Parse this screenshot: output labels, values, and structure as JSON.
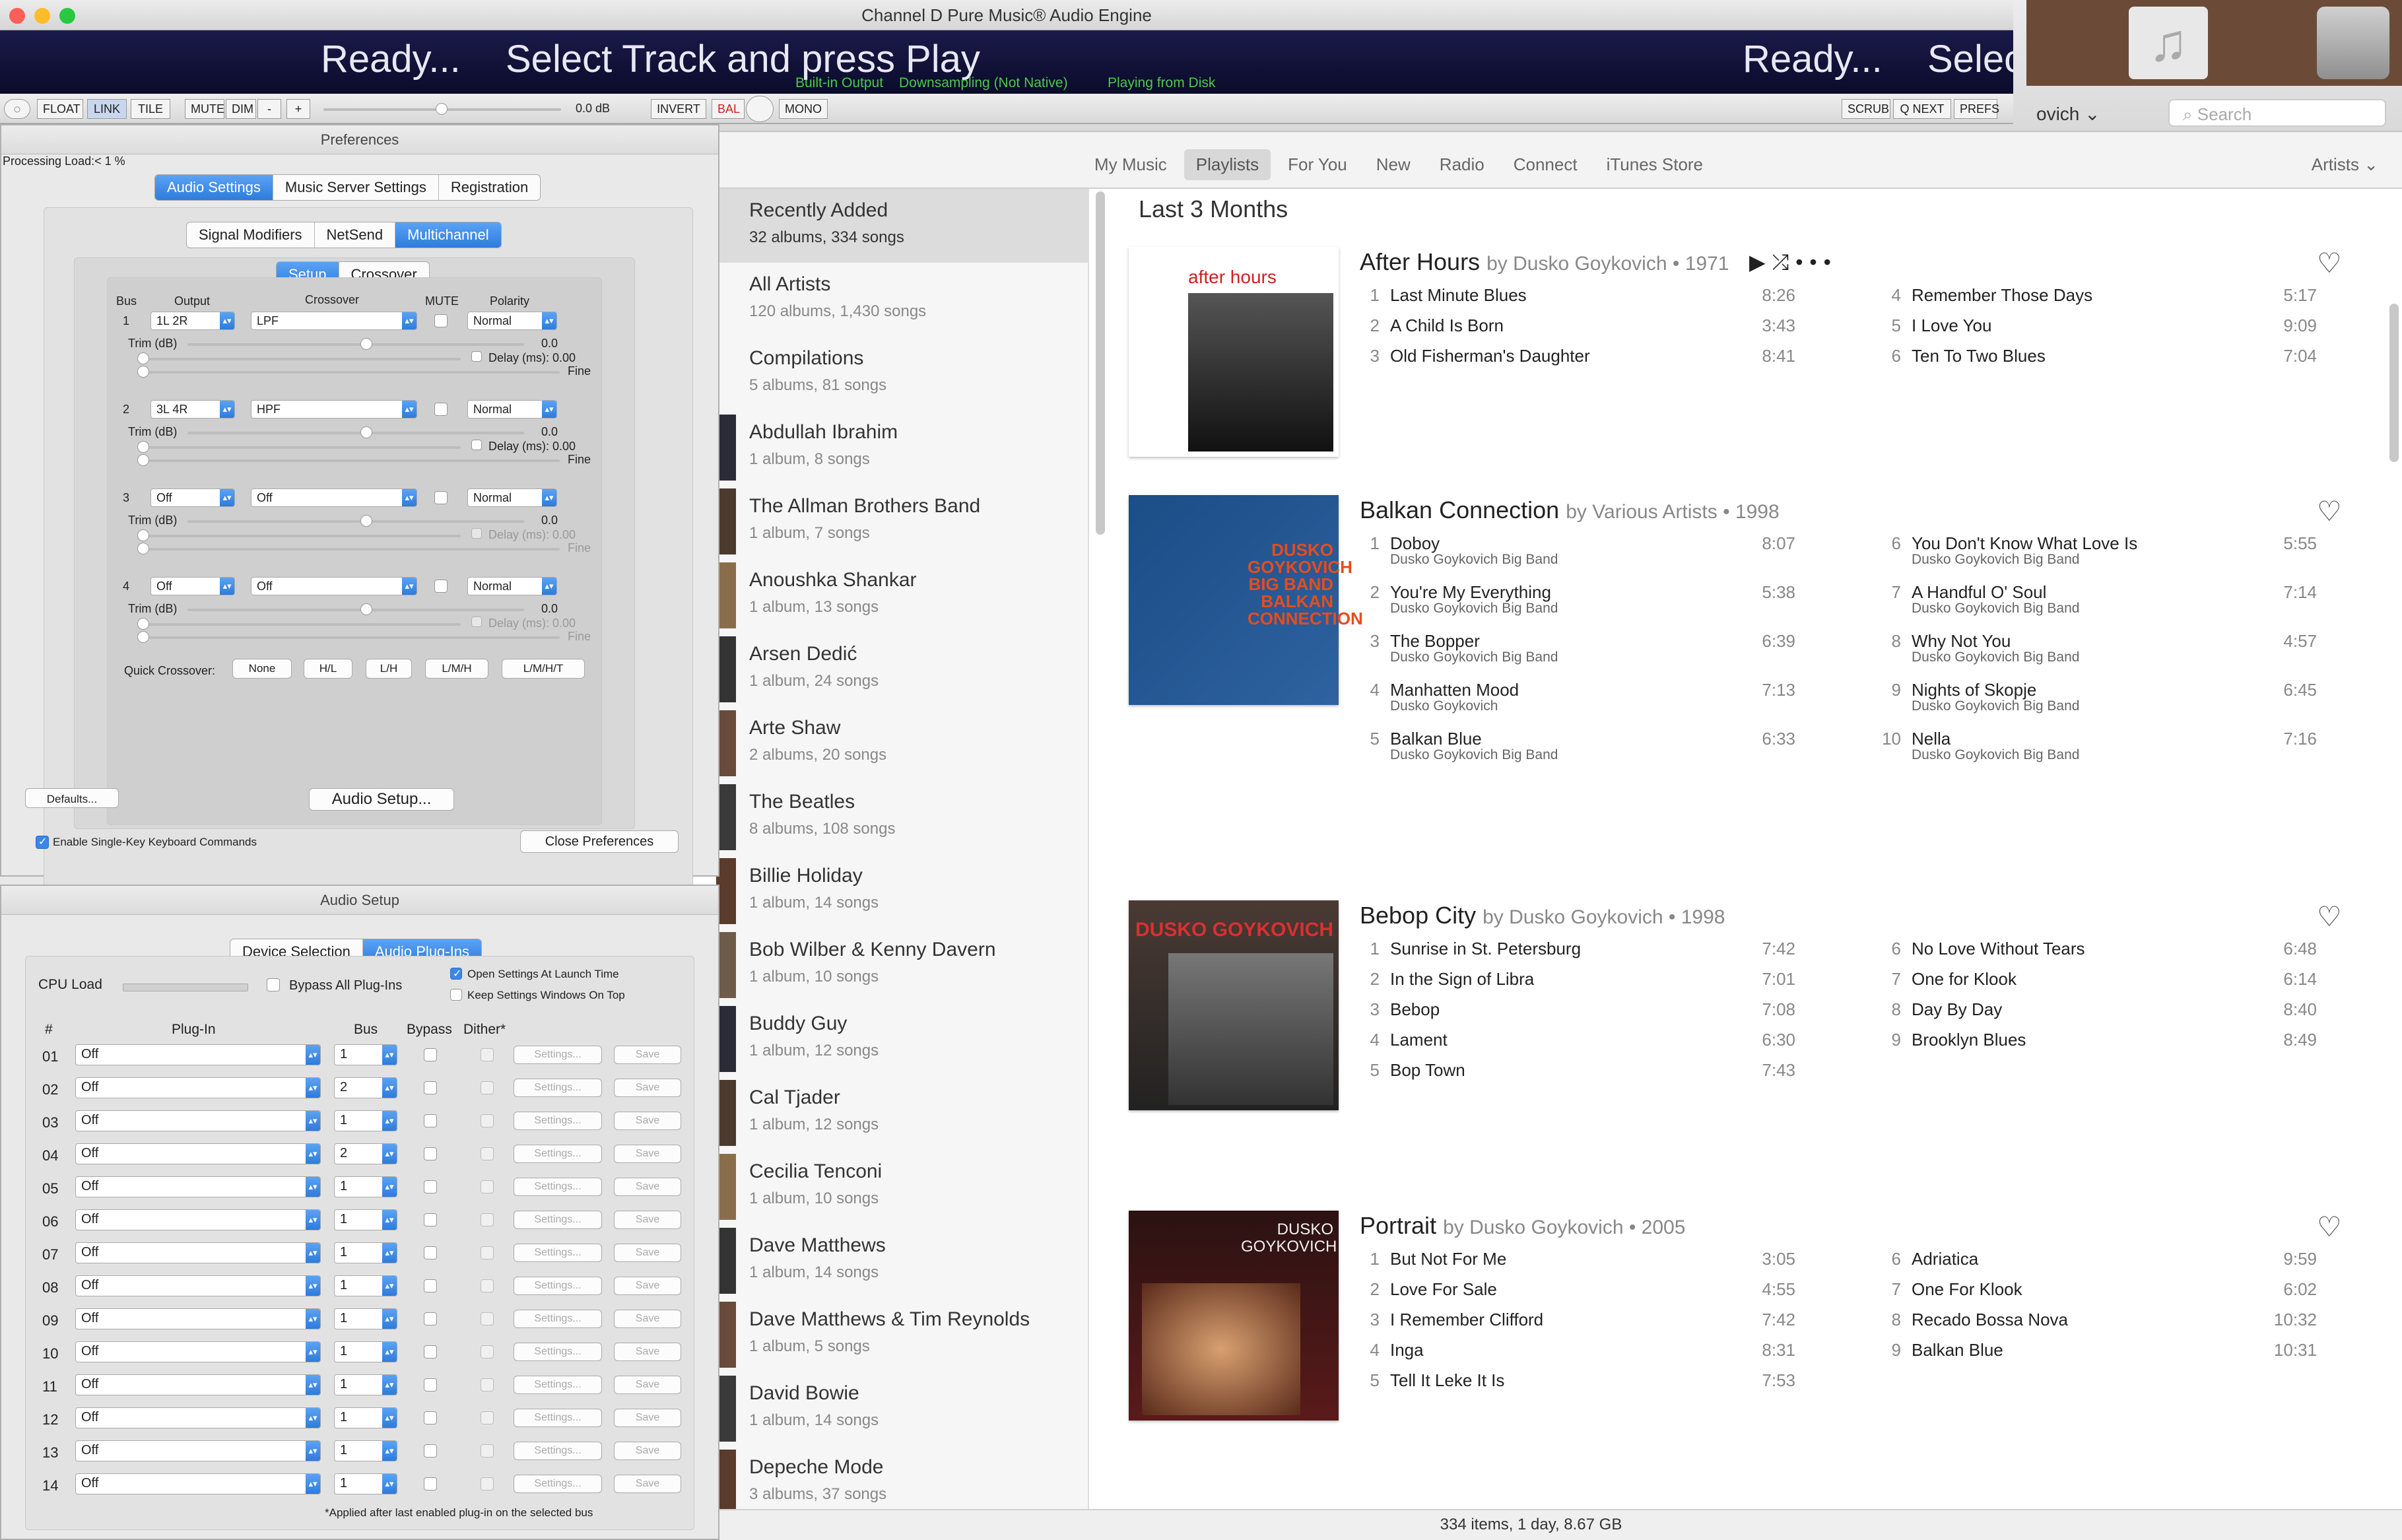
{
  "pure_music": {
    "title": "Channel D Pure Music® Audio Engine",
    "display": {
      "ready1": "Ready...",
      "select": "Select Track and press Play",
      "ready2": "Ready...",
      "select_partial": "Selec",
      "output": "Built-in Output",
      "downsampling": "Downsampling (Not Native)",
      "playing_from": "Playing from Disk"
    },
    "controls": {
      "float": "FLOAT",
      "link": "LINK",
      "tile": "TILE",
      "mute": "MUTE",
      "dim": "DIM",
      "minus": "-",
      "plus": "+",
      "volume": "0.0 dB",
      "invert": "INVERT",
      "bal": "BAL",
      "mono": "MONO",
      "scrub": "SCRUB",
      "qnext": "Q NEXT",
      "prefs": "PREFS"
    }
  },
  "preferences": {
    "title": "Preferences",
    "processing_load": "Processing Load:< 1  %",
    "tabs": [
      "Audio Settings",
      "Music Server Settings",
      "Registration"
    ],
    "subtabs": [
      "Signal Modifiers",
      "NetSend",
      "Multichannel"
    ],
    "inner_tabs": [
      "Setup",
      "Crossover"
    ],
    "headers": {
      "bus": "Bus",
      "output": "Output",
      "crossover": "Crossover",
      "mute": "MUTE",
      "polarity": "Polarity"
    },
    "buses": [
      {
        "num": "1",
        "output": "1L 2R",
        "crossover": "LPF",
        "polarity": "Normal",
        "trim_label": "Trim (dB)",
        "trim_val": "0.0",
        "delay_label": "Delay (ms): 0.00",
        "fine": "Fine",
        "enabled": true
      },
      {
        "num": "2",
        "output": "3L 4R",
        "crossover": "HPF",
        "polarity": "Normal",
        "trim_label": "Trim (dB)",
        "trim_val": "0.0",
        "delay_label": "Delay (ms): 0.00",
        "fine": "Fine",
        "enabled": true
      },
      {
        "num": "3",
        "output": "Off",
        "crossover": "Off",
        "polarity": "Normal",
        "trim_label": "Trim (dB)",
        "trim_val": "0.0",
        "delay_label": "Delay (ms): 0.00",
        "fine": "Fine",
        "enabled": false
      },
      {
        "num": "4",
        "output": "Off",
        "crossover": "Off",
        "polarity": "Normal",
        "trim_label": "Trim (dB)",
        "trim_val": "0.0",
        "delay_label": "Delay (ms): 0.00",
        "fine": "Fine",
        "enabled": false
      }
    ],
    "quick_crossover_label": "Quick Crossover:",
    "quick_crossover": [
      "None",
      "H/L",
      "L/H",
      "L/M/H",
      "L/M/H/T"
    ],
    "defaults": "Defaults...",
    "audio_setup": "Audio Setup...",
    "single_key": "Enable Single-Key Keyboard Commands",
    "close": "Close Preferences"
  },
  "audio_setup": {
    "title": "Audio Setup",
    "tabs": [
      "Device Selection",
      "Audio Plug-Ins"
    ],
    "cpu_load": "CPU Load",
    "bypass_all": "Bypass All Plug-Ins",
    "open_settings": "Open Settings At Launch Time",
    "keep_on_top": "Keep Settings Windows On Top",
    "headers": {
      "num": "#",
      "plugin": "Plug-In",
      "bus": "Bus",
      "bypass": "Bypass",
      "dither": "Dither*"
    },
    "rows": [
      {
        "n": "01",
        "plugin": "Off",
        "bus": "1"
      },
      {
        "n": "02",
        "plugin": "Off",
        "bus": "2"
      },
      {
        "n": "03",
        "plugin": "Off",
        "bus": "1"
      },
      {
        "n": "04",
        "plugin": "Off",
        "bus": "2"
      },
      {
        "n": "05",
        "plugin": "Off",
        "bus": "1"
      },
      {
        "n": "06",
        "plugin": "Off",
        "bus": "1"
      },
      {
        "n": "07",
        "plugin": "Off",
        "bus": "1"
      },
      {
        "n": "08",
        "plugin": "Off",
        "bus": "1"
      },
      {
        "n": "09",
        "plugin": "Off",
        "bus": "1"
      },
      {
        "n": "10",
        "plugin": "Off",
        "bus": "1"
      },
      {
        "n": "11",
        "plugin": "Off",
        "bus": "1"
      },
      {
        "n": "12",
        "plugin": "Off",
        "bus": "1"
      },
      {
        "n": "13",
        "plugin": "Off",
        "bus": "1"
      },
      {
        "n": "14",
        "plugin": "Off",
        "bus": "1"
      }
    ],
    "settings_btn": "Settings...",
    "save_btn": "Save",
    "footnote": "*Applied after last enabled plug-in on the selected bus"
  },
  "itunes": {
    "user": "ovich",
    "search_placeholder": "Search",
    "nav_tabs": [
      "My Music",
      "Playlists",
      "For You",
      "New",
      "Radio",
      "Connect",
      "iTunes Store"
    ],
    "selected_tab": "Playlists",
    "artists_dropdown": "Artists",
    "sidebar": [
      {
        "title": "Recently Added",
        "sub": "32 albums, 334 songs"
      },
      {
        "title": "All Artists",
        "sub": "120 albums, 1,430 songs"
      },
      {
        "title": "Compilations",
        "sub": "5 albums, 81 songs"
      },
      {
        "title": "Abdullah Ibrahim",
        "sub": "1 album, 8 songs"
      },
      {
        "title": "The Allman Brothers Band",
        "sub": "1 album, 7 songs"
      },
      {
        "title": "Anoushka Shankar",
        "sub": "1 album, 13 songs"
      },
      {
        "title": "Arsen Dedić",
        "sub": "1 album, 24 songs"
      },
      {
        "title": "Arte Shaw",
        "sub": "2 albums, 20 songs"
      },
      {
        "title": "The Beatles",
        "sub": "8 albums, 108 songs"
      },
      {
        "title": "Billie Holiday",
        "sub": "1 album, 14 songs"
      },
      {
        "title": "Bob Wilber & Kenny Davern",
        "sub": "1 album, 10 songs"
      },
      {
        "title": "Buddy Guy",
        "sub": "1 album, 12 songs"
      },
      {
        "title": "Cal Tjader",
        "sub": "1 album, 12 songs"
      },
      {
        "title": "Cecilia Tenconi",
        "sub": "1 album, 10 songs"
      },
      {
        "title": "Dave Matthews",
        "sub": "1 album, 14 songs"
      },
      {
        "title": "Dave Matthews & Tim Reynolds",
        "sub": "1 album, 5 songs"
      },
      {
        "title": "David Bowie",
        "sub": "1 album, 14 songs"
      },
      {
        "title": "Depeche Mode",
        "sub": "3 albums, 37 songs"
      }
    ],
    "section_title": "Last 3 Months",
    "albums": [
      {
        "title": "After Hours",
        "byline": "by Dusko Goykovich • 1971",
        "cover_text": "after hours",
        "left": [
          {
            "n": "1",
            "t": "Last Minute Blues",
            "a": "",
            "d": "8:26"
          },
          {
            "n": "2",
            "t": "A Child Is Born",
            "a": "",
            "d": "3:43"
          },
          {
            "n": "3",
            "t": "Old Fisherman's Daughter",
            "a": "",
            "d": "8:41"
          }
        ],
        "right": [
          {
            "n": "4",
            "t": "Remember Those Days",
            "a": "",
            "d": "5:17"
          },
          {
            "n": "5",
            "t": "I Love You",
            "a": "",
            "d": "9:09"
          },
          {
            "n": "6",
            "t": "Ten To Two Blues",
            "a": "",
            "d": "7:04"
          }
        ]
      },
      {
        "title": "Balkan Connection",
        "byline": "by Various Artists • 1998",
        "cover_text": "DUSKO GOYKOVICH BIG BAND BALKAN CONNECTION",
        "left": [
          {
            "n": "1",
            "t": "Doboy",
            "a": "Dusko Goykovich Big Band",
            "d": "8:07"
          },
          {
            "n": "2",
            "t": "You're My Everything",
            "a": "Dusko Goykovich Big Band",
            "d": "5:38"
          },
          {
            "n": "3",
            "t": "The Bopper",
            "a": "Dusko Goykovich Big Band",
            "d": "6:39"
          },
          {
            "n": "4",
            "t": "Manhatten Mood",
            "a": "Dusko Goykovich",
            "d": "7:13"
          },
          {
            "n": "5",
            "t": "Balkan Blue",
            "a": "Dusko Goykovich Big Band",
            "d": "6:33"
          }
        ],
        "right": [
          {
            "n": "6",
            "t": "You Don't Know What Love Is",
            "a": "Dusko Goykovich Big Band",
            "d": "5:55"
          },
          {
            "n": "7",
            "t": "A Handful O' Soul",
            "a": "Dusko Goykovich Big Band",
            "d": "7:14"
          },
          {
            "n": "8",
            "t": "Why Not You",
            "a": "Dusko Goykovich Big Band",
            "d": "4:57"
          },
          {
            "n": "9",
            "t": "Nights of Skopje",
            "a": "Dusko Goykovich Big Band",
            "d": "6:45"
          },
          {
            "n": "10",
            "t": "Nella",
            "a": "Dusko Goykovich Big Band",
            "d": "7:16"
          }
        ]
      },
      {
        "title": "Bebop City",
        "byline": "by Dusko Goykovich • 1998",
        "cover_text": "DUSKO GOYKOVICH",
        "left": [
          {
            "n": "1",
            "t": "Sunrise in St. Petersburg",
            "a": "",
            "d": "7:42"
          },
          {
            "n": "2",
            "t": "In the Sign of Libra",
            "a": "",
            "d": "7:01"
          },
          {
            "n": "3",
            "t": "Bebop",
            "a": "",
            "d": "7:08"
          },
          {
            "n": "4",
            "t": "Lament",
            "a": "",
            "d": "6:30"
          },
          {
            "n": "5",
            "t": "Bop Town",
            "a": "",
            "d": "7:43"
          }
        ],
        "right": [
          {
            "n": "6",
            "t": "No Love Without Tears",
            "a": "",
            "d": "6:48"
          },
          {
            "n": "7",
            "t": "One for Klook",
            "a": "",
            "d": "6:14"
          },
          {
            "n": "8",
            "t": "Day By Day",
            "a": "",
            "d": "8:40"
          },
          {
            "n": "9",
            "t": "Brooklyn Blues",
            "a": "",
            "d": "8:49"
          }
        ]
      },
      {
        "title": "Portrait",
        "byline": "by Dusko Goykovich • 2005",
        "cover_text": "DUSKO GOYKOVICH",
        "left": [
          {
            "n": "1",
            "t": "But Not For Me",
            "a": "",
            "d": "3:05"
          },
          {
            "n": "2",
            "t": "Love For Sale",
            "a": "",
            "d": "4:55"
          },
          {
            "n": "3",
            "t": "I Remember Clifford",
            "a": "",
            "d": "7:42"
          },
          {
            "n": "4",
            "t": "Inga",
            "a": "",
            "d": "8:31"
          },
          {
            "n": "5",
            "t": "Tell It Leke It Is",
            "a": "",
            "d": "7:53"
          }
        ],
        "right": [
          {
            "n": "6",
            "t": "Adriatica",
            "a": "",
            "d": "9:59"
          },
          {
            "n": "7",
            "t": "One For Klook",
            "a": "",
            "d": "6:02"
          },
          {
            "n": "8",
            "t": "Recado Bossa Nova",
            "a": "",
            "d": "10:32"
          },
          {
            "n": "9",
            "t": "Balkan Blue",
            "a": "",
            "d": "10:31"
          }
        ]
      }
    ],
    "status": "334 items, 1 day, 8.67 GB"
  },
  "colors": {
    "accent": "#2e7bdc",
    "display_bg": "#0b0b2a",
    "display_green": "#4cc84c"
  }
}
